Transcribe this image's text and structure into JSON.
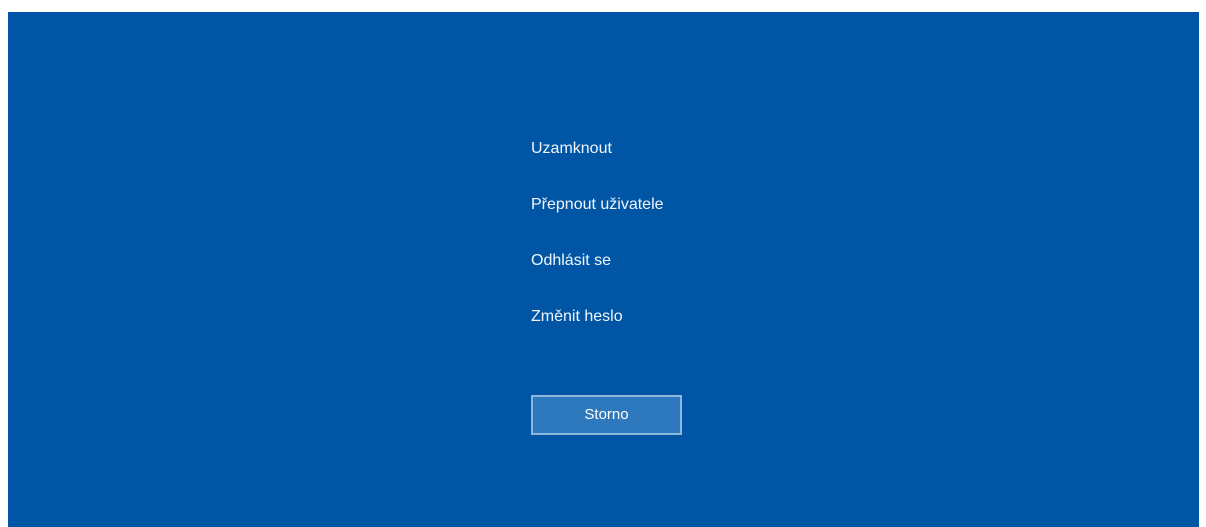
{
  "menu": {
    "items": [
      {
        "label": "Uzamknout"
      },
      {
        "label": "Přepnout uživatele"
      },
      {
        "label": "Odhlásit se"
      },
      {
        "label": "Změnit heslo"
      }
    ]
  },
  "cancel_label": "Storno",
  "colors": {
    "background": "#0055a5",
    "text": "#f2f6fb",
    "button_fill": "#2e78bd",
    "button_border": "#8fb6dd"
  }
}
